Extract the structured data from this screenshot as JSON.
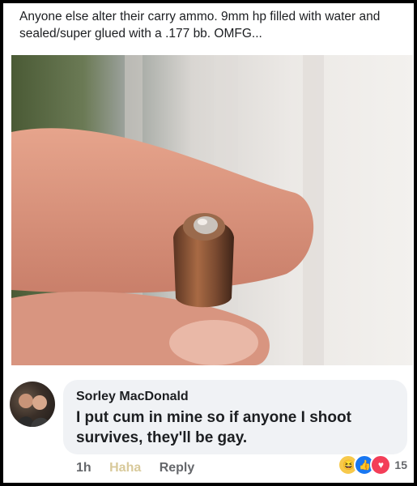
{
  "post": {
    "text": "Anyone else alter their carry ammo. 9mm hp filled with water and sealed/super glued with a .177 bb. OMFG..."
  },
  "comment": {
    "author": "Sorley MacDonald",
    "text": "I put cum in mine so if anyone I shoot survives, they'll be gay.",
    "time": "1h",
    "haha_label": "Haha",
    "reply_label": "Reply",
    "reaction_count": "15",
    "reactions": [
      "haha-icon",
      "like-icon",
      "love-icon"
    ]
  },
  "colors": {
    "bubble": "#f0f2f5",
    "text": "#1c1e21",
    "meta": "#65676b",
    "haha": "#d8c99a"
  }
}
